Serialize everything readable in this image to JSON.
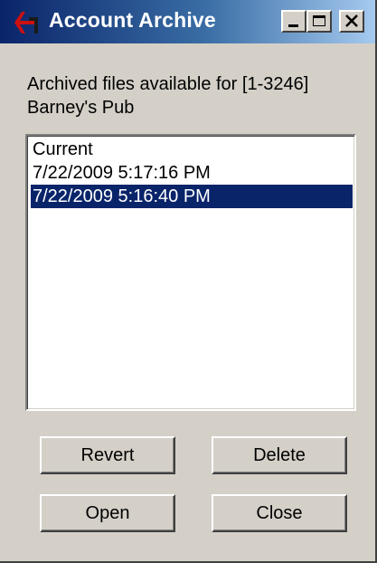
{
  "window": {
    "title": "Account Archive",
    "icon": "red-arrow-app-icon",
    "controls": {
      "minimize": "minimize-icon",
      "maximize": "maximize-icon",
      "close": "close-icon"
    }
  },
  "prompt": {
    "line1": "Archived files available for [1-3246]",
    "line2": "Barney's Pub"
  },
  "archive_list": {
    "items": [
      {
        "label": "Current",
        "selected": false
      },
      {
        "label": "7/22/2009 5:17:16 PM",
        "selected": false
      },
      {
        "label": "7/22/2009 5:16:40 PM",
        "selected": true
      }
    ]
  },
  "buttons": {
    "revert": "Revert",
    "delete": "Delete",
    "open": "Open",
    "close": "Close"
  },
  "colors": {
    "titlebar_start": "#0a246a",
    "titlebar_end": "#a6caf0",
    "face": "#d4d0c8",
    "selection": "#0a246a"
  }
}
